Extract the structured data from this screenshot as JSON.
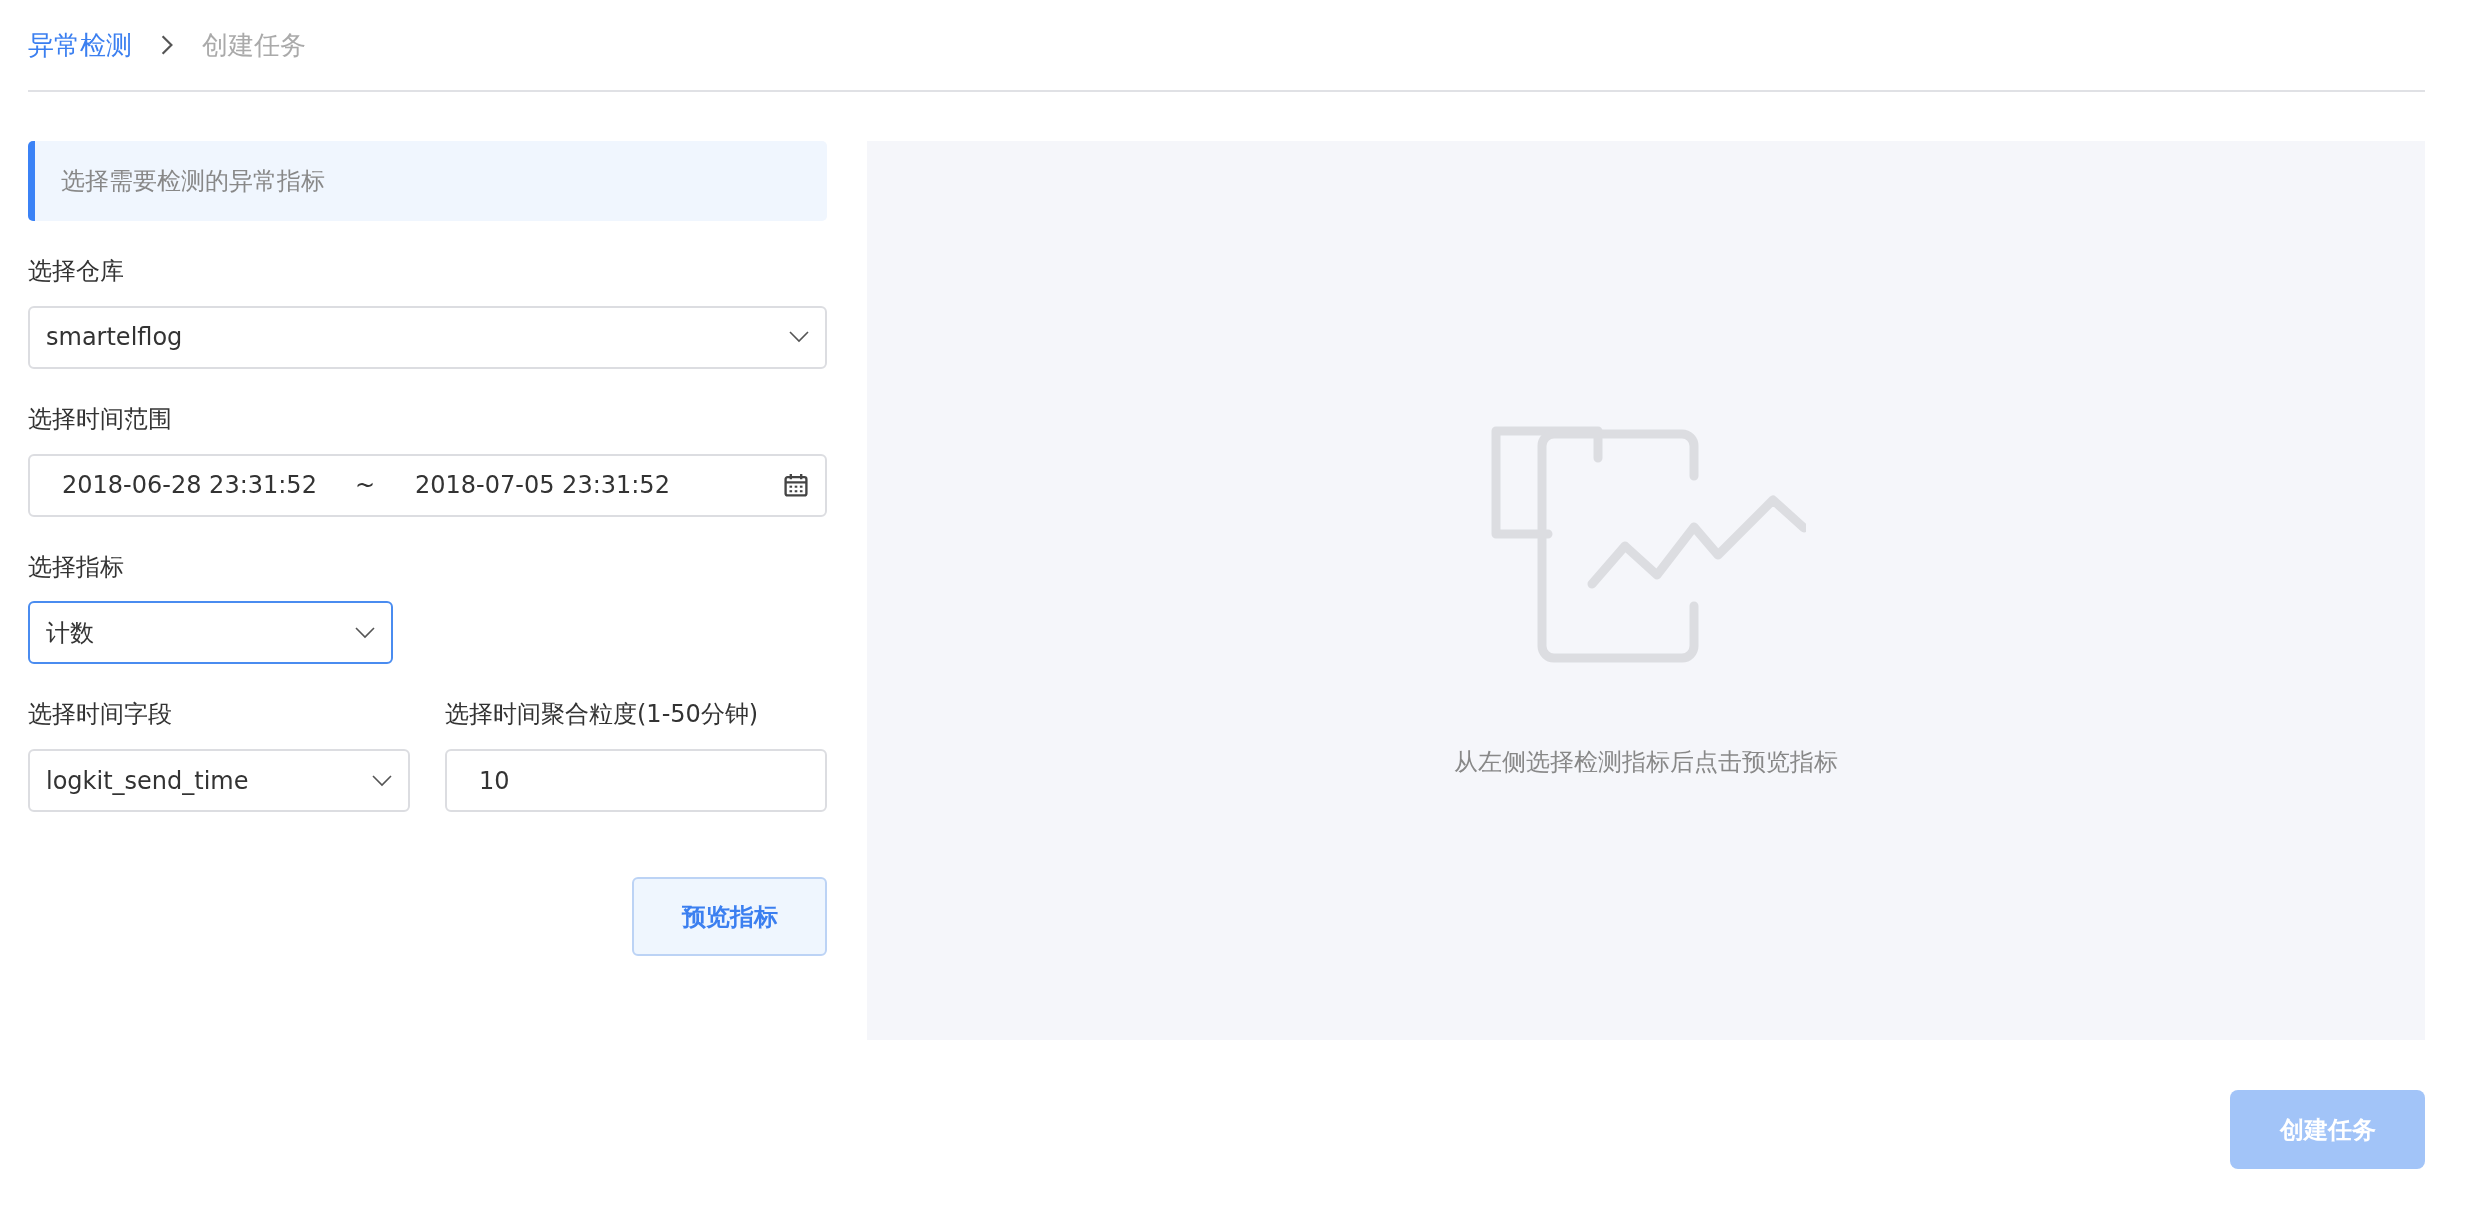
{
  "breadcrumb": [
    {
      "label": "异常检测",
      "current": false
    },
    {
      "label": "创建任务",
      "current": true
    }
  ],
  "section_title": "选择需要检测的异常指标",
  "warehouse": {
    "label": "选择仓库",
    "value": "smartelflog"
  },
  "time_range": {
    "label": "选择时间范围",
    "start": "2018-06-28 23:31:52",
    "separator": "~",
    "end": "2018-07-05 23:31:52"
  },
  "metric": {
    "label": "选择指标",
    "value": "计数",
    "focused": true
  },
  "time_field": {
    "label": "选择时间字段",
    "value": "logkit_send_time"
  },
  "granularity": {
    "label": "选择时间聚合粒度(1-50分钟)",
    "value": "10"
  },
  "preview_button": "预览指标",
  "preview_panel": {
    "message": "从左侧选择检测指标后点击预览指标"
  },
  "create_button": {
    "label": "创建任务",
    "disabled": true
  }
}
